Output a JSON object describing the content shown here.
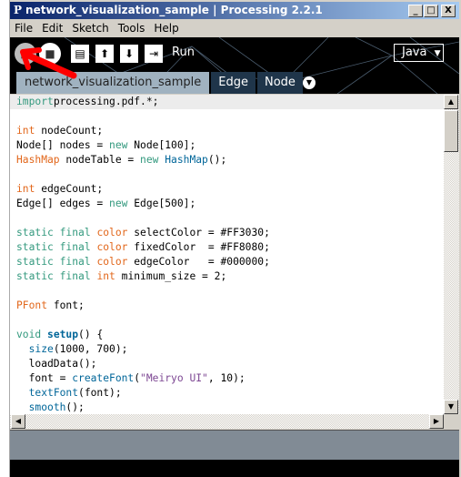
{
  "window": {
    "app_icon": "P",
    "title": "network_visualization_sample | Processing 2.2.1",
    "minimize": "_",
    "maximize": "□",
    "close": "X"
  },
  "menu": [
    "File",
    "Edit",
    "Sketch",
    "Tools",
    "Help"
  ],
  "toolbar": {
    "run_label": "Run",
    "mode": "Java",
    "mode_arrow": "▼",
    "icons": [
      "run-icon",
      "stop-icon",
      "new-icon",
      "open-icon",
      "save-icon",
      "export-icon"
    ]
  },
  "tabs": [
    {
      "label": "network_visualization_sample",
      "active": true
    },
    {
      "label": "Edge"
    },
    {
      "label": "Node"
    }
  ],
  "colors": {
    "keyword": "#33997e",
    "type": "#e2661a",
    "function": "#006699",
    "string": "#7d4793",
    "annotation_arrow": "#ff0000"
  },
  "code": [
    [
      [
        "kw",
        "import"
      ],
      [
        "",
        "processing.pdf.*;"
      ]
    ],
    [],
    [
      [
        "ty",
        "int"
      ],
      [
        "",
        " nodeCount;"
      ]
    ],
    [
      [
        "",
        "Node[] nodes = "
      ],
      [
        "kw",
        "new"
      ],
      [
        "",
        " Node[100];"
      ]
    ],
    [
      [
        "ty",
        "HashMap"
      ],
      [
        "",
        " nodeTable = "
      ],
      [
        "kw",
        "new"
      ],
      [
        "",
        " "
      ],
      [
        "fn",
        "HashMap"
      ],
      [
        "",
        "();"
      ]
    ],
    [],
    [
      [
        "ty",
        "int"
      ],
      [
        "",
        " edgeCount;"
      ]
    ],
    [
      [
        "",
        "Edge[] edges = "
      ],
      [
        "kw",
        "new"
      ],
      [
        "",
        " Edge[500];"
      ]
    ],
    [],
    [
      [
        "kw",
        "static final"
      ],
      [
        "",
        " "
      ],
      [
        "ty",
        "color"
      ],
      [
        "",
        " selectColor = #FF3030;"
      ]
    ],
    [
      [
        "kw",
        "static final"
      ],
      [
        "",
        " "
      ],
      [
        "ty",
        "color"
      ],
      [
        "",
        " fixedColor  = #FF8080;"
      ]
    ],
    [
      [
        "kw",
        "static final"
      ],
      [
        "",
        " "
      ],
      [
        "ty",
        "color"
      ],
      [
        "",
        " edgeColor   = #000000;"
      ]
    ],
    [
      [
        "kw",
        "static final"
      ],
      [
        "",
        " "
      ],
      [
        "ty",
        "int"
      ],
      [
        "",
        " minimum_size = 2;"
      ]
    ],
    [],
    [
      [
        "ty",
        "PFont"
      ],
      [
        "",
        " font;"
      ]
    ],
    [],
    [
      [
        "kw",
        "void"
      ],
      [
        "",
        " "
      ],
      [
        "fn b",
        "setup"
      ],
      [
        "",
        "() {"
      ]
    ],
    [
      [
        "",
        "  "
      ],
      [
        "fn",
        "size"
      ],
      [
        "",
        "(1000, 700);"
      ]
    ],
    [
      [
        "",
        "  loadData();"
      ]
    ],
    [
      [
        "",
        "  font = "
      ],
      [
        "fn",
        "createFont"
      ],
      [
        "",
        "("
      ],
      [
        "st",
        "\"Meiryo UI\""
      ],
      [
        "",
        ", 10);"
      ]
    ],
    [
      [
        "",
        "  "
      ],
      [
        "fn",
        "textFont"
      ],
      [
        "",
        "(font);"
      ]
    ],
    [
      [
        "",
        "  "
      ],
      [
        "fn",
        "smooth"
      ],
      [
        "",
        "();"
      ]
    ]
  ]
}
